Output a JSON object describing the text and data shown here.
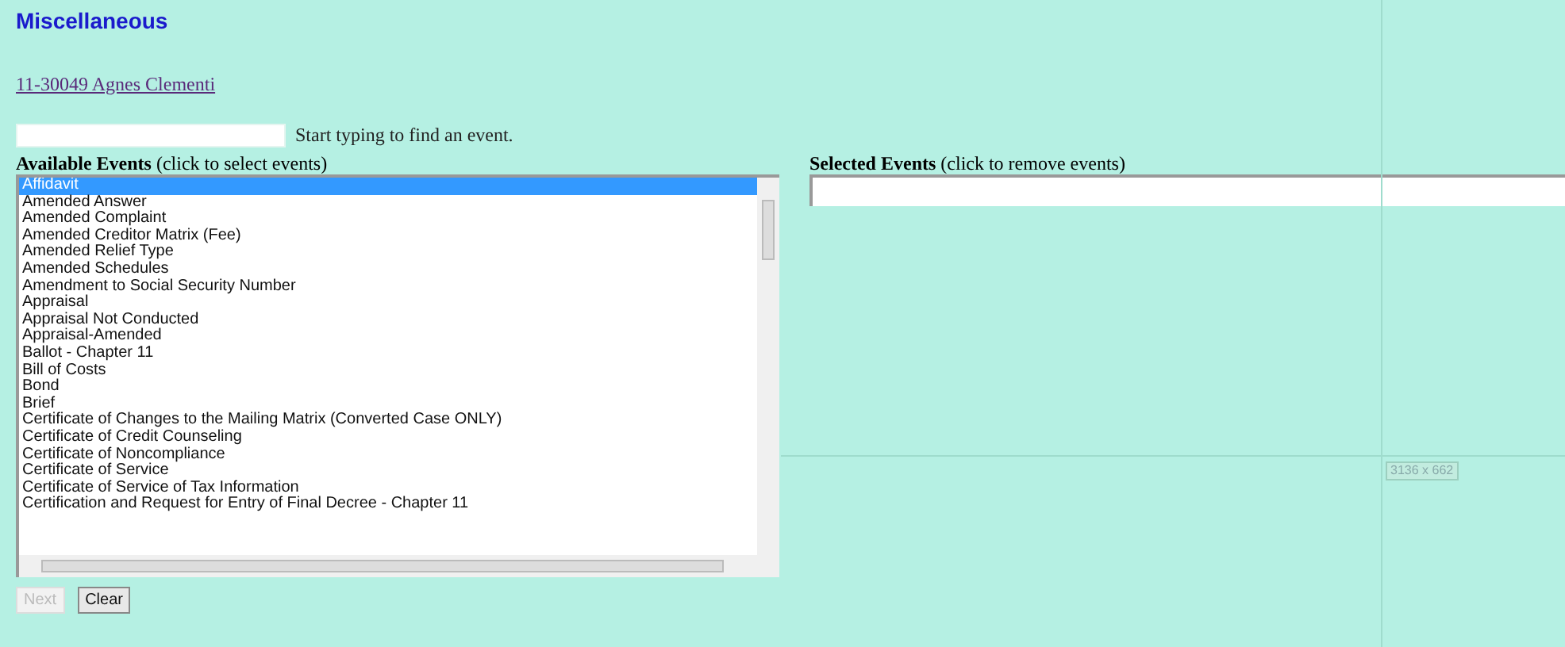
{
  "title": "Miscellaneous",
  "case_link": "11-30049 Agnes Clementi",
  "search": {
    "hint": "Start typing to find an event."
  },
  "available": {
    "label": "Available Events",
    "note": "(click to select events)",
    "items": [
      {
        "label": "Affidavit",
        "selected": true
      },
      {
        "label": "Amended Answer",
        "selected": false
      },
      {
        "label": "Amended Complaint",
        "selected": false
      },
      {
        "label": "Amended Creditor Matrix (Fee)",
        "selected": false
      },
      {
        "label": "Amended Relief Type",
        "selected": false
      },
      {
        "label": "Amended Schedules",
        "selected": false
      },
      {
        "label": "Amendment to Social Security Number",
        "selected": false
      },
      {
        "label": "Appraisal",
        "selected": false
      },
      {
        "label": "Appraisal Not Conducted",
        "selected": false
      },
      {
        "label": "Appraisal-Amended",
        "selected": false
      },
      {
        "label": "Ballot - Chapter 11",
        "selected": false
      },
      {
        "label": "Bill of Costs",
        "selected": false
      },
      {
        "label": "Bond",
        "selected": false
      },
      {
        "label": "Brief",
        "selected": false
      },
      {
        "label": "Certificate of Changes to the Mailing Matrix (Converted Case ONLY)",
        "selected": false
      },
      {
        "label": "Certificate of Credit Counseling",
        "selected": false
      },
      {
        "label": "Certificate of Noncompliance",
        "selected": false
      },
      {
        "label": "Certificate of Service",
        "selected": false
      },
      {
        "label": "Certificate of Service of Tax Information",
        "selected": false
      },
      {
        "label": "Certification and Request for Entry of Final Decree - Chapter 11",
        "selected": false
      }
    ]
  },
  "selected_events": {
    "label": "Selected Events",
    "note": "(click to remove events)"
  },
  "buttons": [
    {
      "label": "Next",
      "disabled": true
    },
    {
      "label": "Clear",
      "disabled": false
    }
  ],
  "measure_label": "3136 x 662"
}
